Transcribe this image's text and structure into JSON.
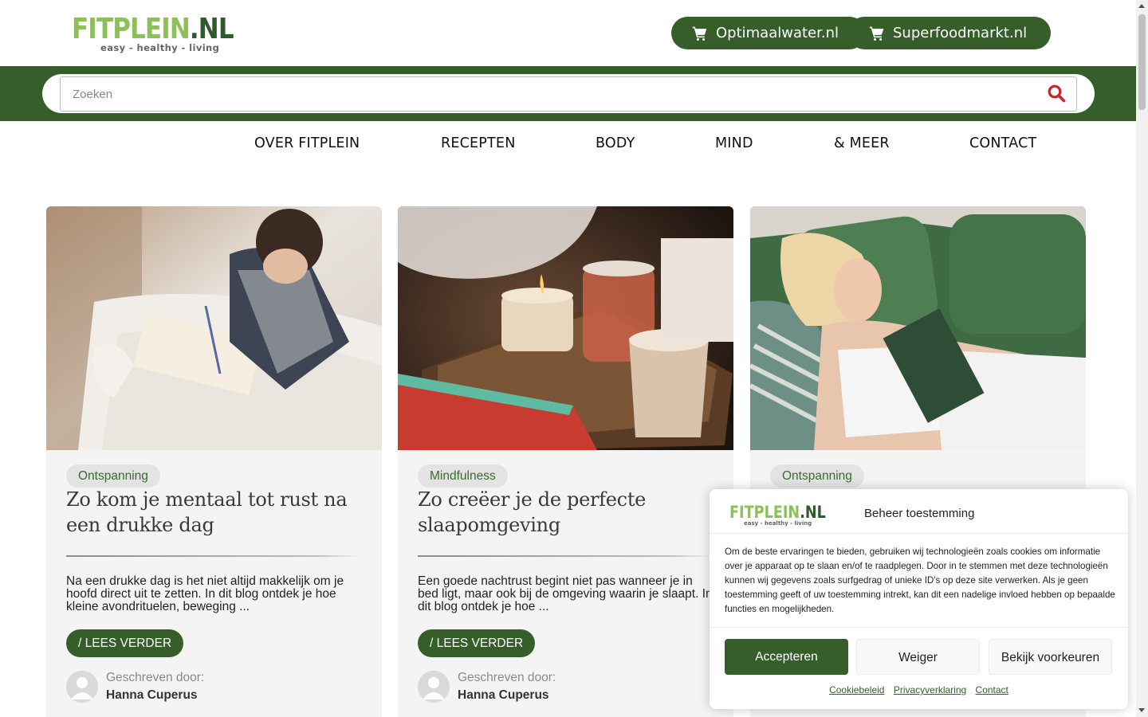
{
  "header": {
    "logo": {
      "brand_main": "FITPLEIN",
      "brand_suffix": ".NL",
      "tagline": "easy - healthy - living"
    },
    "shop_links": [
      {
        "label": "Optimaalwater.nl",
        "icon": "cart-icon"
      },
      {
        "label": "Superfoodmarkt.nl",
        "icon": "cart-icon"
      }
    ]
  },
  "search": {
    "placeholder": "Zoeken",
    "value": "",
    "icon": "search-icon"
  },
  "nav": {
    "items": [
      {
        "label": "OVER FITPLEIN"
      },
      {
        "label": "RECEPTEN"
      },
      {
        "label": "BODY"
      },
      {
        "label": "MIND"
      },
      {
        "label": "& MEER"
      },
      {
        "label": "CONTACT"
      }
    ]
  },
  "posts": [
    {
      "category": "Ontspanning",
      "title": "Zo kom je mentaal tot rust na een drukke dag",
      "excerpt": "Na een drukke dag is het niet altijd makkelijk om je hoofd direct uit te zetten. In dit blog ontdek je hoe kleine avondrituelen, beweging ...",
      "read_more": "/ LEES VERDER",
      "written_by_label": "Geschreven door:",
      "author": "Hanna Cuperus"
    },
    {
      "category": "Mindfulness",
      "title": "Zo creëer je de perfecte slaapomgeving",
      "excerpt": "Een goede nachtrust begint niet pas wanneer je in bed ligt, maar ook bij de omgeving waarin je slaapt. In dit blog ontdek je hoe ...",
      "read_more": "/ LEES VERDER",
      "written_by_label": "Geschreven door:",
      "author": "Hanna Cuperus"
    },
    {
      "category": "Ontspanning"
    }
  ],
  "cookie_banner": {
    "logo": {
      "brand_main": "FITPLEIN",
      "brand_suffix": ".NL",
      "tagline": "easy - healthy - living"
    },
    "title": "Beheer toestemming",
    "text": "Om de beste ervaringen te bieden, gebruiken wij technologieën zoals cookies om informatie over je apparaat op te slaan en/of te raadplegen. Door in te stemmen met deze technologieën kunnen wij gegevens zoals surfgedrag of unieke ID's op deze site verwerken. Als je geen toestemming geeft of uw toestemming intrekt, kan dit een nadelige invloed hebben op bepaalde functies en mogelijkheden.",
    "buttons": {
      "accept": "Accepteren",
      "deny": "Weiger",
      "preferences": "Bekijk voorkeuren"
    },
    "links": [
      "Cookiebeleid",
      "Privacyverklaring",
      "Contact"
    ]
  },
  "colors": {
    "brand_green": "#355e2a",
    "brand_light_green": "#8dbf5a",
    "search_icon_red": "#c62828",
    "card_bg": "#f4f4f4"
  }
}
